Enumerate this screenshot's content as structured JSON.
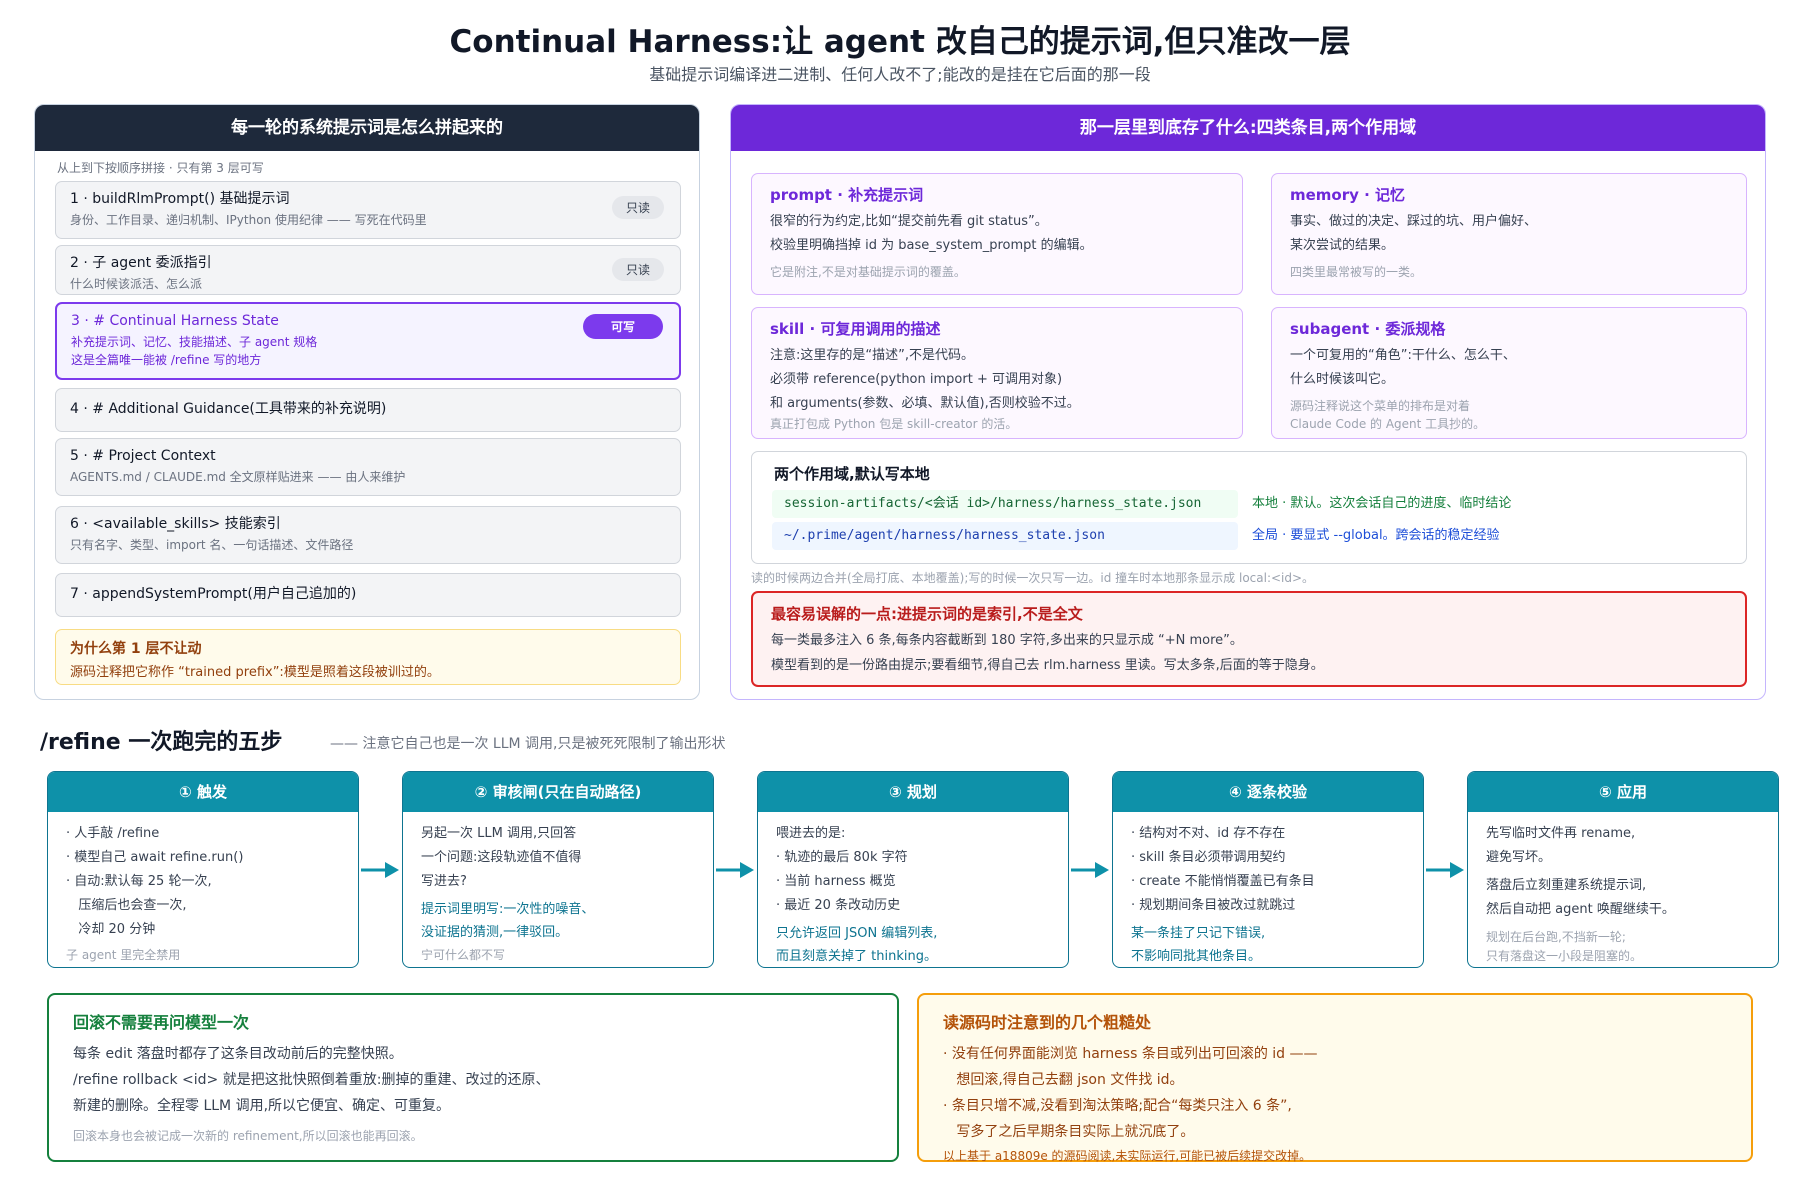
{
  "header": {
    "title": "Continual Harness:让 agent 改自己的提示词,但只准改一层",
    "subtitle": "基础提示词编译进二进制、任何人改不了;能改的是挂在它后面的那一段"
  },
  "left_panel": {
    "heading": "每一轮的系统提示词是怎么拼起来的",
    "hint": "从上到下按顺序拼接 · 只有第 3 层可写",
    "layers": [
      {
        "title": "1 · buildRlmPrompt() 基础提示词",
        "desc": "身份、工作目录、递归机制、IPython 使用纪律 —— 写死在代码里",
        "badge": "只读"
      },
      {
        "title": "2 · 子 agent 委派指引",
        "desc": "什么时候该派活、怎么派",
        "badge": "只读"
      },
      {
        "title": "3 · # Continual Harness State",
        "desc": "补充提示词、记忆、技能描述、子 agent 规格",
        "desc2": "这是全篇唯一能被 /refine 写的地方",
        "badge": "可写"
      },
      {
        "title": "4 · # Additional Guidance(工具带来的补充说明)"
      },
      {
        "title": "5 · # Project Context",
        "desc": "AGENTS.md / CLAUDE.md 全文原样贴进来 —— 由人来维护"
      },
      {
        "title": "6 · <available_skills> 技能索引",
        "desc": "只有名字、类型、import 名、一句话描述、文件路径"
      },
      {
        "title": "7 · appendSystemPrompt(用户自己追加的)"
      }
    ],
    "note": {
      "title": "为什么第 1 层不让动",
      "text": "源码注释把它称作 “trained prefix”:模型是照着这段被训过的。"
    }
  },
  "right_panel": {
    "heading": "那一层里到底存了什么:四类条目,两个作用域",
    "cards": {
      "prompt": {
        "title": "prompt · 补充提示词",
        "lines": [
          "很窄的行为约定,比如“提交前先看 git status”。",
          "校验里明确挡掉 id 为 base_system_prompt 的编辑。"
        ],
        "muted": "它是附注,不是对基础提示词的覆盖。"
      },
      "memory": {
        "title": "memory · 记忆",
        "lines": [
          "事实、做过的决定、踩过的坑、用户偏好、",
          "某次尝试的结果。"
        ],
        "muted": "四类里最常被写的一类。"
      },
      "skill": {
        "title": "skill · 可复用调用的描述",
        "lines": [
          "注意:这里存的是“描述”,不是代码。",
          "必须带 reference(python import + 可调用对象)",
          "和 arguments(参数、必填、默认值),否则校验不过。"
        ],
        "muted": "真正打包成 Python 包是 skill-creator 的活。"
      },
      "subagent": {
        "title": "subagent · 委派规格",
        "lines": [
          "一个可复用的“角色”:干什么、怎么干、",
          "什么时候该叫它。"
        ],
        "muted": "源码注释说这个菜单的排布是对着",
        "muted2": "Claude Code 的 Agent 工具抄的。"
      }
    },
    "scope": {
      "title": "两个作用域,默认写本地",
      "local_path": "session-artifacts/<会话 id>/harness/harness_state.json",
      "local_desc": "本地 · 默认。这次会话自己的进度、临时结论",
      "global_path": "~/.prime/agent/harness/harness_state.json",
      "global_desc": "全局 · 要显式 --global。跨会话的稳定经验",
      "note": "读的时候两边合并(全局打底、本地覆盖);写的时候一次只写一边。id 撞车时本地那条显示成 local:<id>。"
    },
    "warning": {
      "title": "最容易误解的一点:进提示词的是索引,不是全文",
      "lines": [
        "每一类最多注入 6 条,每条内容截断到 180 字符,多出来的只显示成 “+N more”。",
        "模型看到的是一份路由提示;要看细节,得自己去 rlm.harness 里读。写太多条,后面的等于隐身。"
      ]
    }
  },
  "refine": {
    "title": "/refine 一次跑完的五步",
    "note": "—— 注意它自己也是一次 LLM 调用,只是被死死限制了输出形状",
    "steps": [
      {
        "head": "① 触发",
        "lines": [
          "· 人手敲 /refine",
          "· 模型自己 await refine.run()",
          "· 自动:默认每 25 轮一次,",
          "   压缩后也会查一次,",
          "   冷却 20 分钟"
        ],
        "muted": "子 agent 里完全禁用"
      },
      {
        "head": "② 审核闸(只在自动路径)",
        "lines": [
          "另起一次 LLM 调用,只回答",
          "一个问题:这段轨迹值不值得",
          "写进去?"
        ],
        "teal": [
          "提示词里明写:一次性的噪音、",
          "没证据的猜测,一律驳回。"
        ],
        "muted": "宁可什么都不写"
      },
      {
        "head": "③ 规划",
        "lines": [
          "喂进去的是:",
          "· 轨迹的最后 80k 字符",
          "· 当前 harness 概览",
          "· 最近 20 条改动历史"
        ],
        "teal": [
          "只允许返回 JSON 编辑列表,",
          "而且刻意关掉了 thinking。"
        ]
      },
      {
        "head": "④ 逐条校验",
        "lines": [
          "· 结构对不对、id 存不存在",
          "· skill 条目必须带调用契约",
          "· create 不能悄悄覆盖已有条目",
          "· 规划期间条目被改过就跳过"
        ],
        "teal": [
          "某一条挂了只记下错误,",
          "不影响同批其他条目。"
        ]
      },
      {
        "head": "⑤ 应用",
        "lines": [
          "先写临时文件再 rename,",
          "避免写坏。"
        ],
        "lines2": [
          "落盘后立刻重建系统提示词,",
          "然后自动把 agent 唤醒继续干。"
        ],
        "muted": "规划在后台跑,不挡新一轮;",
        "muted2": "只有落盘这一小段是阻塞的。"
      }
    ]
  },
  "rollback": {
    "title": "回滚不需要再问模型一次",
    "lines": [
      "每条 edit 落盘时都存了这条目改动前后的完整快照。",
      "/refine rollback <id> 就是把这批快照倒着重放:删掉的重建、改过的还原、",
      "新建的删除。全程零 LLM 调用,所以它便宜、确定、可重复。"
    ],
    "muted": "回滚本身也会被记成一次新的 refinement,所以回滚也能再回滚。"
  },
  "rough_edges": {
    "title": "读源码时注意到的几个粗糙处",
    "lines": [
      "· 没有任何界面能浏览 harness 条目或列出可回滚的 id ——",
      "   想回滚,得自己去翻 json 文件找 id。",
      "· 条目只增不减,没看到淘汰策略;配合“每类只注入 6 条”,",
      "   写多了之后早期条目实际上就沉底了。"
    ],
    "muted": "以上基于 a18809e 的源码阅读,未实际运行,可能已被后续提交改掉。"
  },
  "colors": {
    "accent_purple": "#7c3aed",
    "dark_header": "#1e293b",
    "teal": "#0e91a9",
    "warning_red": "#dc2626",
    "note_amber": "#f59e0b",
    "rollback_green": "#15803d"
  }
}
